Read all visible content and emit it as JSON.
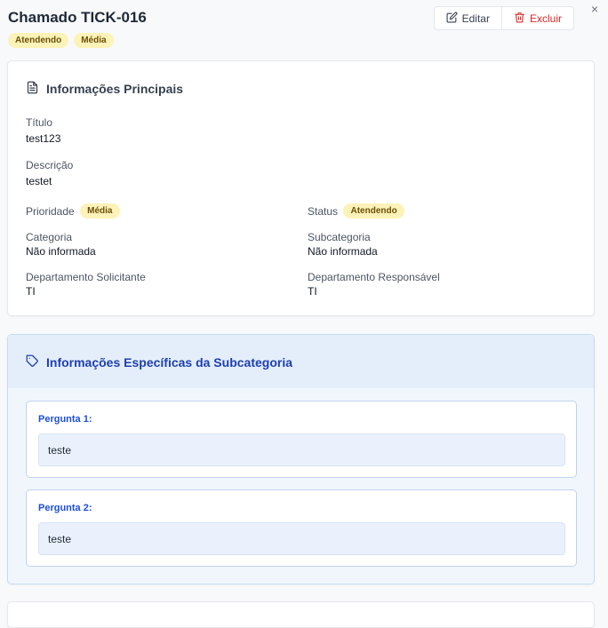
{
  "header": {
    "title": "Chamado TICK-016",
    "badges": [
      "Atendendo",
      "Média"
    ],
    "edit_label": "Editar",
    "delete_label": "Excluir",
    "close_symbol": "×"
  },
  "main": {
    "title": "Informações Principais",
    "titulo_label": "Título",
    "titulo_value": "test123",
    "descricao_label": "Descrição",
    "descricao_value": "testet",
    "prioridade_label": "Prioridade",
    "prioridade_value": "Média",
    "status_label": "Status",
    "status_value": "Atendendo",
    "categoria_label": "Categoria",
    "categoria_value": "Não informada",
    "subcategoria_label": "Subcategoria",
    "subcategoria_value": "Não informada",
    "dep_sol_label": "Departamento Solicitante",
    "dep_sol_value": "TI",
    "dep_resp_label": "Departamento Responsável",
    "dep_resp_value": "TI"
  },
  "specific": {
    "title": "Informações Específicas da Subcategoria",
    "questions": [
      {
        "label": "Pergunta 1:",
        "answer": "teste"
      },
      {
        "label": "Pergunta 2:",
        "answer": "teste"
      }
    ]
  },
  "colors": {
    "badge_bg": "#fdf3b8",
    "accent_blue": "#1e40af",
    "danger": "#dc2626"
  },
  "icons": {
    "edit": "edit-icon",
    "delete": "trash-icon",
    "document": "document-icon",
    "tag": "tag-icon",
    "close": "close-icon"
  }
}
